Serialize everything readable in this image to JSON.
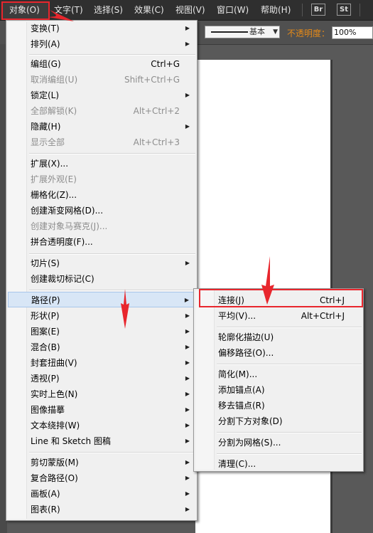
{
  "menubar": {
    "items": [
      "对象(O)",
      "文字(T)",
      "选择(S)",
      "效果(C)",
      "视图(V)",
      "窗口(W)",
      "帮助(H)"
    ],
    "bridge_label": "Br",
    "stock_label": "St"
  },
  "options": {
    "stroke_style": "基本",
    "opacity_label": "不透明度：",
    "opacity_value": "100%"
  },
  "main_menu": {
    "items": [
      {
        "label": "变换(T)",
        "arrow": true
      },
      {
        "label": "排列(A)",
        "arrow": true
      },
      {
        "label": "编组(G)",
        "shortcut": "Ctrl+G"
      },
      {
        "label": "取消编组(U)",
        "shortcut": "Shift+Ctrl+G",
        "disabled": true
      },
      {
        "label": "锁定(L)",
        "arrow": true
      },
      {
        "label": "全部解锁(K)",
        "shortcut": "Alt+Ctrl+2",
        "disabled": true
      },
      {
        "label": "隐藏(H)",
        "arrow": true
      },
      {
        "label": "显示全部",
        "shortcut": "Alt+Ctrl+3",
        "disabled": true
      },
      {
        "label": "扩展(X)..."
      },
      {
        "label": "扩展外观(E)",
        "disabled": true
      },
      {
        "label": "栅格化(Z)..."
      },
      {
        "label": "创建渐变网格(D)..."
      },
      {
        "label": "创建对象马赛克(J)...",
        "disabled": true
      },
      {
        "label": "拼合透明度(F)..."
      },
      {
        "label": "切片(S)",
        "arrow": true
      },
      {
        "label": "创建裁切标记(C)"
      },
      {
        "label": "路径(P)",
        "arrow": true,
        "selected": true
      },
      {
        "label": "形状(P)",
        "arrow": true
      },
      {
        "label": "图案(E)",
        "arrow": true
      },
      {
        "label": "混合(B)",
        "arrow": true
      },
      {
        "label": "封套扭曲(V)",
        "arrow": true
      },
      {
        "label": "透视(P)",
        "arrow": true
      },
      {
        "label": "实时上色(N)",
        "arrow": true
      },
      {
        "label": "图像描摹",
        "arrow": true
      },
      {
        "label": "文本绕排(W)",
        "arrow": true
      },
      {
        "label": "Line 和 Sketch 图稿",
        "arrow": true
      },
      {
        "label": "剪切蒙版(M)",
        "arrow": true
      },
      {
        "label": "复合路径(O)",
        "arrow": true
      },
      {
        "label": "画板(A)",
        "arrow": true
      },
      {
        "label": "图表(R)",
        "arrow": true
      }
    ]
  },
  "path_submenu": {
    "items": [
      {
        "label": "连接(J)",
        "shortcut": "Ctrl+J"
      },
      {
        "label": "平均(V)...",
        "shortcut": "Alt+Ctrl+J"
      },
      {
        "label": "轮廓化描边(U)"
      },
      {
        "label": "偏移路径(O)..."
      },
      {
        "label": "简化(M)..."
      },
      {
        "label": "添加锚点(A)"
      },
      {
        "label": "移去锚点(R)"
      },
      {
        "label": "分割下方对象(D)"
      },
      {
        "label": "分割为网格(S)..."
      },
      {
        "label": "清理(C)..."
      }
    ]
  },
  "colors": {
    "highlight_red": "#e8262d",
    "opacity_label": "#e58a18",
    "menu_bg": "#f0f0f0"
  }
}
